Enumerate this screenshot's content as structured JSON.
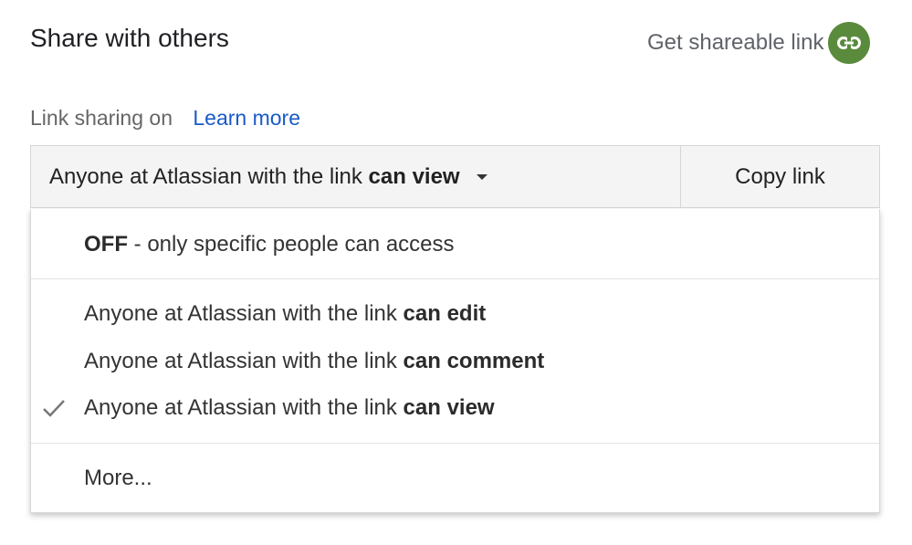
{
  "header": {
    "title": "Share with others",
    "get_link_label": "Get shareable link",
    "link_icon": "link-icon",
    "link_icon_color": "#5a8a3c"
  },
  "sharing": {
    "status": "Link sharing on",
    "learn_more": "Learn more",
    "link_color": "#1a5ac8"
  },
  "dropdown": {
    "current_prefix": "Anyone at Atlassian with the link ",
    "current_permission": "can view",
    "caret_icon": "caret-down-icon",
    "copy_label": "Copy link"
  },
  "menu": {
    "off_bold": "OFF",
    "off_rest": " - only specific people can access",
    "options": [
      {
        "prefix": "Anyone at Atlassian with the link ",
        "permission": "can edit",
        "selected": false
      },
      {
        "prefix": "Anyone at Atlassian with the link ",
        "permission": "can comment",
        "selected": false
      },
      {
        "prefix": "Anyone at Atlassian with the link ",
        "permission": "can view",
        "selected": true
      }
    ],
    "check_icon": "checkmark-icon",
    "more": "More..."
  }
}
